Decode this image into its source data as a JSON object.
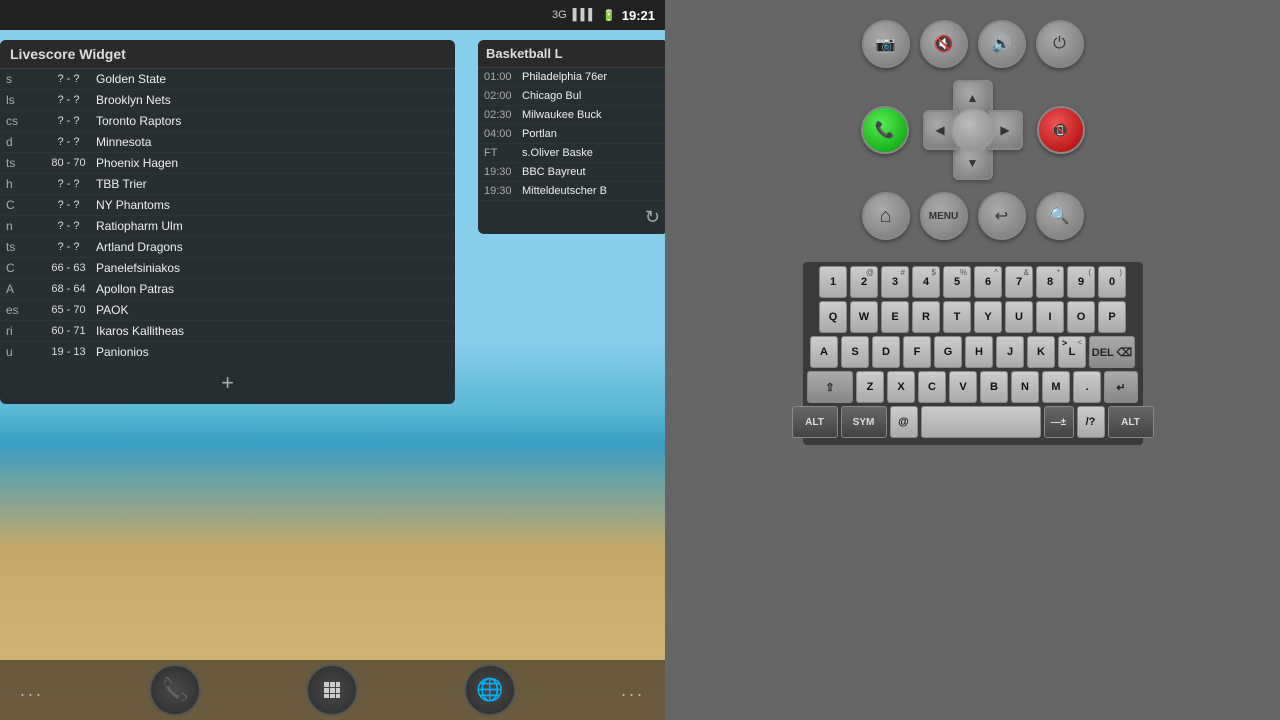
{
  "statusBar": {
    "time": "19:21",
    "icons": [
      "3G",
      "signal",
      "battery"
    ]
  },
  "livescoreWidget": {
    "title": "Livescore Widget",
    "rows": [
      {
        "teamLeft": "s",
        "score": "? - ?",
        "teamRight": "Golden State"
      },
      {
        "teamLeft": "ls",
        "score": "? - ?",
        "teamRight": "Brooklyn Nets"
      },
      {
        "teamLeft": "cs",
        "score": "? - ?",
        "teamRight": "Toronto Raptors"
      },
      {
        "teamLeft": "d",
        "score": "? - ?",
        "teamRight": "Minnesota"
      },
      {
        "teamLeft": "ts",
        "score": "80 - 70",
        "teamRight": "Phoenix Hagen"
      },
      {
        "teamLeft": "h",
        "score": "? - ?",
        "teamRight": "TBB Trier"
      },
      {
        "teamLeft": "C",
        "score": "? - ?",
        "teamRight": "NY Phantoms"
      },
      {
        "teamLeft": "n",
        "score": "? - ?",
        "teamRight": "Ratiopharm Ulm"
      },
      {
        "teamLeft": "ts",
        "score": "? - ?",
        "teamRight": "Artland Dragons"
      },
      {
        "teamLeft": "C",
        "score": "66 - 63",
        "teamRight": "Panelefsiniakos"
      },
      {
        "teamLeft": "A",
        "score": "68 - 64",
        "teamRight": "Apollon Patras"
      },
      {
        "teamLeft": "es",
        "score": "65 - 70",
        "teamRight": "PAOK"
      },
      {
        "teamLeft": "ri",
        "score": "60 - 71",
        "teamRight": "Ikaros Kallitheas"
      },
      {
        "teamLeft": "u",
        "score": "19 - 13",
        "teamRight": "Panionios"
      }
    ],
    "addButton": "+"
  },
  "basketballPanel": {
    "title": "Basketball L",
    "rows": [
      {
        "time": "01:00",
        "team": "Philadelphia 76er"
      },
      {
        "time": "02:00",
        "team": "Chicago Bul"
      },
      {
        "time": "02:30",
        "team": "Milwaukee Buck"
      },
      {
        "time": "04:00",
        "team": "Portlan"
      },
      {
        "time": "FT",
        "team": "s.Oliver Baske"
      },
      {
        "time": "19:30",
        "team": "BBC Bayreut"
      },
      {
        "time": "19:30",
        "team": "Mitteldeutscher B"
      }
    ]
  },
  "controls": {
    "cameraIcon": "📷",
    "volumeDownIcon": "🔇",
    "volumeUpIcon": "🔊",
    "powerIcon": "⏻",
    "callIcon": "📞",
    "endCallIcon": "📵",
    "homeIcon": "⌂",
    "menuLabel": "MENU",
    "backIcon": "↩",
    "searchIcon": "🔍"
  },
  "keyboard": {
    "rows": [
      [
        "1",
        "2",
        "3",
        "4",
        "5",
        "6",
        "7",
        "8",
        "9",
        "0"
      ],
      [
        "Q",
        "W",
        "E",
        "R",
        "T",
        "Y",
        "U",
        "I",
        "O",
        "P"
      ],
      [
        "A",
        "S",
        "D",
        "F",
        "G",
        "H",
        "J",
        "K",
        "L",
        "⌫"
      ],
      [
        "⇧",
        "Z",
        "X",
        "C",
        "V",
        "B",
        "N",
        "M",
        ".",
        "↵"
      ],
      [
        "ALT",
        "SYM",
        "@",
        "SPACE",
        "—±",
        "/?",
        "ALT"
      ]
    ],
    "topChars": {
      "1": "",
      "2": "@",
      "3": "#",
      "4": "$",
      "5": "%",
      "6": "^",
      "7": "&",
      "8": "*",
      "9": "(",
      "0": ")",
      "Q": "",
      "W": "",
      "E": "",
      "R": "",
      "T": "",
      "Y": "",
      "U": "",
      "I": "",
      "O": "",
      "P": "",
      "A": "",
      "S": "",
      "D": "",
      "F": "",
      "G": "",
      "H": "",
      "J": "",
      "K": "",
      "L": ""
    }
  },
  "bottomNav": {
    "leftDots": "...",
    "rightDots": "...",
    "callLabel": "📞",
    "appsLabel": "⠿",
    "browserLabel": "🌐"
  }
}
